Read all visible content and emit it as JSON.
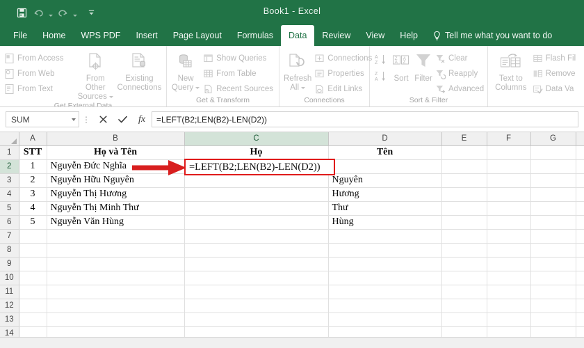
{
  "window": {
    "title_name": "Book1",
    "title_dash": "-",
    "title_app": "Excel",
    "accent_color": "#217346"
  },
  "quick_access": [
    {
      "name": "save-icon",
      "label": "Save"
    },
    {
      "name": "undo-icon",
      "label": "Undo"
    },
    {
      "name": "redo-icon",
      "label": "Redo"
    },
    {
      "name": "customize-quick-access-icon",
      "label": "Customize Quick Access Toolbar"
    }
  ],
  "tabs": [
    {
      "label": "File",
      "active": false
    },
    {
      "label": "Home",
      "active": false
    },
    {
      "label": "WPS PDF",
      "active": false
    },
    {
      "label": "Insert",
      "active": false
    },
    {
      "label": "Page Layout",
      "active": false
    },
    {
      "label": "Formulas",
      "active": false
    },
    {
      "label": "Data",
      "active": true
    },
    {
      "label": "Review",
      "active": false
    },
    {
      "label": "View",
      "active": false
    },
    {
      "label": "Help",
      "active": false
    }
  ],
  "tell_me": {
    "label": "Tell me what you want to do",
    "icon": "lightbulb-icon"
  },
  "ribbon": {
    "groups": [
      {
        "label": "Get External Data",
        "small": [
          {
            "label": "From Access",
            "icon": "from-access-icon"
          },
          {
            "label": "From Web",
            "icon": "from-web-icon"
          },
          {
            "label": "From Text",
            "icon": "from-text-icon"
          }
        ],
        "big": [
          {
            "label_line1": "From Other",
            "label_line2": "Sources",
            "icon": "from-other-sources-icon",
            "has_caret": true
          },
          {
            "label_line1": "Existing",
            "label_line2": "Connections",
            "icon": "existing-connections-icon",
            "has_caret": false
          }
        ]
      },
      {
        "label": "Get & Transform",
        "big": [
          {
            "label_line1": "New",
            "label_line2": "Query",
            "icon": "new-query-icon",
            "has_caret": true
          }
        ],
        "small": [
          {
            "label": "Show Queries",
            "icon": "show-queries-icon"
          },
          {
            "label": "From Table",
            "icon": "from-table-icon"
          },
          {
            "label": "Recent Sources",
            "icon": "recent-sources-icon"
          }
        ]
      },
      {
        "label": "Connections",
        "big": [
          {
            "label_line1": "Refresh",
            "label_line2": "All",
            "icon": "refresh-all-icon",
            "has_caret": true
          }
        ],
        "small": [
          {
            "label": "Connections",
            "icon": "connections-icon"
          },
          {
            "label": "Properties",
            "icon": "properties-icon"
          },
          {
            "label": "Edit Links",
            "icon": "edit-links-icon"
          }
        ]
      },
      {
        "label": "Sort & Filter",
        "sort_icons": [
          {
            "name": "sort-a-to-z-icon",
            "label": "Sort A to Z"
          },
          {
            "name": "sort-z-to-a-icon",
            "label": "Sort Z to A"
          }
        ],
        "big": [
          {
            "label_line1": "",
            "label_line2": "Sort",
            "icon": "sort-dialog-icon",
            "has_caret": false
          },
          {
            "label_line1": "",
            "label_line2": "Filter",
            "icon": "filter-icon",
            "has_caret": false
          }
        ],
        "small": [
          {
            "label": "Clear",
            "icon": "clear-filter-icon"
          },
          {
            "label": "Reapply",
            "icon": "reapply-icon"
          },
          {
            "label": "Advanced",
            "icon": "advanced-filter-icon"
          }
        ]
      },
      {
        "label": "",
        "big": [
          {
            "label_line1": "Text to",
            "label_line2": "Columns",
            "icon": "text-to-columns-icon",
            "has_caret": false
          }
        ],
        "small": [
          {
            "label": "Flash Fil",
            "icon": "flash-fill-icon"
          },
          {
            "label": "Remove",
            "icon": "remove-duplicates-icon"
          },
          {
            "label": "Data Va",
            "icon": "data-validation-icon"
          }
        ]
      }
    ]
  },
  "formula_bar": {
    "name_box_value": "SUM",
    "cancel_label": "Cancel",
    "enter_label": "Enter",
    "fx_label": "Insert Function",
    "formula": "=LEFT(B2;LEN(B2)-LEN(D2))"
  },
  "sheet": {
    "column_headers": [
      "A",
      "B",
      "C",
      "D",
      "E",
      "F",
      "G"
    ],
    "selected_column": "C",
    "row_headers": [
      "1",
      "2",
      "3",
      "4",
      "5",
      "6",
      "7",
      "8",
      "9",
      "10",
      "11",
      "12",
      "13",
      "14"
    ],
    "selected_row": "2",
    "rows": [
      {
        "num": "1",
        "A": "STT",
        "B": "Họ và Tên",
        "C": "Họ",
        "D": "Tên",
        "E": "",
        "F": "",
        "G": "",
        "header": true
      },
      {
        "num": "2",
        "A": "1",
        "B": "Nguyễn Đức Nghĩa",
        "C": "",
        "D": "",
        "E": "",
        "F": "",
        "G": "",
        "header": false
      },
      {
        "num": "3",
        "A": "2",
        "B": "Nguyễn Hữu Nguyên",
        "C": "",
        "D": "Nguyên",
        "E": "",
        "F": "",
        "G": "",
        "header": false
      },
      {
        "num": "4",
        "A": "3",
        "B": "Nguyễn Thị Hương",
        "C": "",
        "D": "Hương",
        "E": "",
        "F": "",
        "G": "",
        "header": false
      },
      {
        "num": "5",
        "A": "4",
        "B": "Nguyễn Thị Minh Thư",
        "C": "",
        "D": "Thư",
        "E": "",
        "F": "",
        "G": "",
        "header": false
      },
      {
        "num": "6",
        "A": "5",
        "B": "Nguyễn Văn Hùng",
        "C": "",
        "D": "Hùng",
        "E": "",
        "F": "",
        "G": "",
        "header": false
      },
      {
        "num": "7",
        "A": "",
        "B": "",
        "C": "",
        "D": "",
        "E": "",
        "F": "",
        "G": "",
        "header": false
      },
      {
        "num": "8",
        "A": "",
        "B": "",
        "C": "",
        "D": "",
        "E": "",
        "F": "",
        "G": "",
        "header": false
      },
      {
        "num": "9",
        "A": "",
        "B": "",
        "C": "",
        "D": "",
        "E": "",
        "F": "",
        "G": "",
        "header": false
      },
      {
        "num": "10",
        "A": "",
        "B": "",
        "C": "",
        "D": "",
        "E": "",
        "F": "",
        "G": "",
        "header": false
      },
      {
        "num": "11",
        "A": "",
        "B": "",
        "C": "",
        "D": "",
        "E": "",
        "F": "",
        "G": "",
        "header": false
      },
      {
        "num": "12",
        "A": "",
        "B": "",
        "C": "",
        "D": "",
        "E": "",
        "F": "",
        "G": "",
        "header": false
      },
      {
        "num": "13",
        "A": "",
        "B": "",
        "C": "",
        "D": "",
        "E": "",
        "F": "",
        "G": "",
        "header": false
      },
      {
        "num": "14",
        "A": "",
        "B": "",
        "C": "",
        "D": "",
        "E": "",
        "F": "",
        "G": "",
        "header": false
      }
    ]
  },
  "active_cell_editor": {
    "text": "=LEFT(B2;LEN(B2)-LEN(D2))",
    "border_color": "#e01b1b"
  },
  "annotation": {
    "arrow_color": "#d81f1f",
    "arrow_name": "red-arrow-pointing-to-formula"
  }
}
